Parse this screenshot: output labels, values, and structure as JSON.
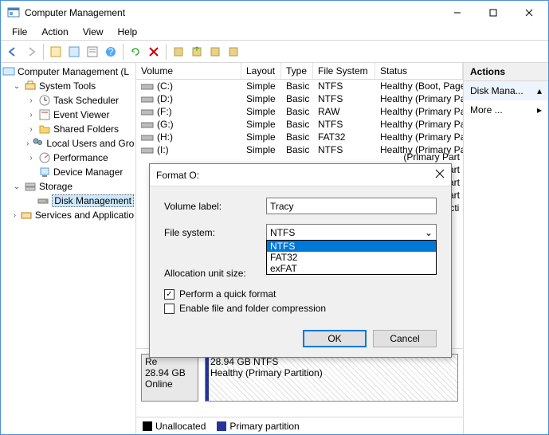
{
  "window": {
    "title": "Computer Management"
  },
  "menus": {
    "file": "File",
    "action": "Action",
    "view": "View",
    "help": "Help"
  },
  "tree": {
    "root": "Computer Management (L",
    "system_tools": "System Tools",
    "task_scheduler": "Task Scheduler",
    "event_viewer": "Event Viewer",
    "shared_folders": "Shared Folders",
    "local_users": "Local Users and Gro",
    "performance": "Performance",
    "device_manager": "Device Manager",
    "storage": "Storage",
    "disk_management": "Disk Management",
    "services": "Services and Applicatio"
  },
  "list": {
    "headers": {
      "volume": "Volume",
      "layout": "Layout",
      "type": "Type",
      "fs": "File System",
      "status": "Status"
    },
    "rows": [
      {
        "vol": "(C:)",
        "lay": "Simple",
        "typ": "Basic",
        "fs": "NTFS",
        "st": "Healthy (Boot, Page F"
      },
      {
        "vol": "(D:)",
        "lay": "Simple",
        "typ": "Basic",
        "fs": "NTFS",
        "st": "Healthy (Primary Part"
      },
      {
        "vol": "(F:)",
        "lay": "Simple",
        "typ": "Basic",
        "fs": "RAW",
        "st": "Healthy (Primary Part"
      },
      {
        "vol": "(G:)",
        "lay": "Simple",
        "typ": "Basic",
        "fs": "NTFS",
        "st": "Healthy (Primary Part"
      },
      {
        "vol": "(H:)",
        "lay": "Simple",
        "typ": "Basic",
        "fs": "FAT32",
        "st": "Healthy (Primary Part"
      },
      {
        "vol": "(I:)",
        "lay": "Simple",
        "typ": "Basic",
        "fs": "NTFS",
        "st": "Healthy (Primary Part"
      }
    ],
    "overflow": [
      "(Primary Part",
      "(Primary Part",
      "(Primary Part",
      "(Primary Part",
      "(System, Acti"
    ]
  },
  "graphical": {
    "disk_label": "Re",
    "disk_size": "28.94 GB",
    "disk_state": "Online",
    "part_size": "28.94 GB NTFS",
    "part_state": "Healthy (Primary Partition)"
  },
  "legend": {
    "unallocated": "Unallocated",
    "primary": "Primary partition"
  },
  "actions": {
    "header": "Actions",
    "disk": "Disk Mana...",
    "more": "More ..."
  },
  "dialog": {
    "title": "Format O:",
    "labels": {
      "volume": "Volume label:",
      "fs": "File system:",
      "alloc": "Allocation unit size:"
    },
    "volume_value": "Tracy",
    "fs_selected": "NTFS",
    "fs_options": [
      "NTFS",
      "FAT32",
      "exFAT"
    ],
    "chk_quick": "Perform a quick format",
    "chk_compress": "Enable file and folder compression",
    "ok": "OK",
    "cancel": "Cancel"
  }
}
